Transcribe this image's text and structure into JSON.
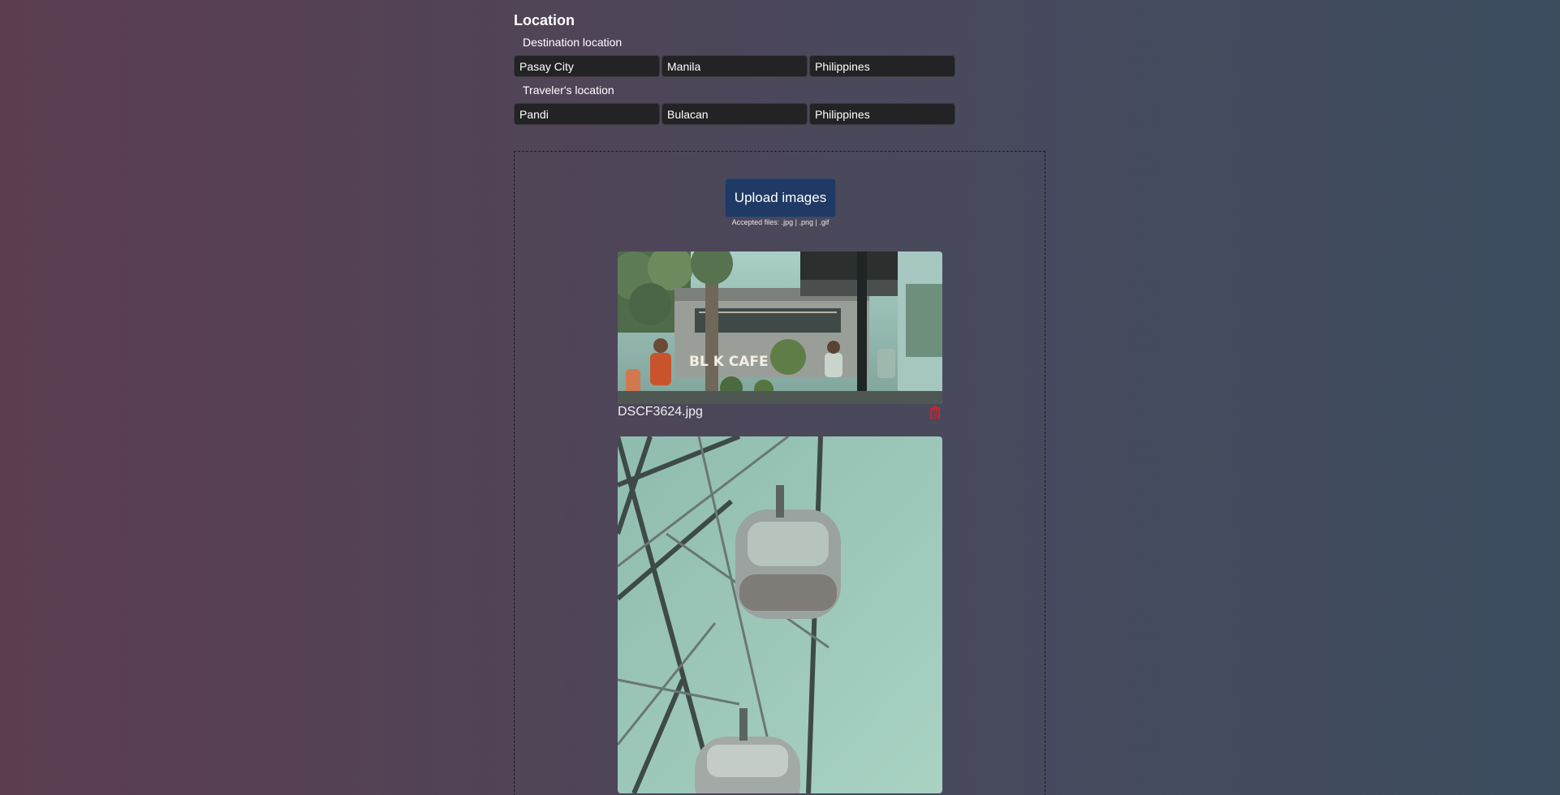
{
  "location": {
    "title": "Location",
    "destination": {
      "label": "Destination location",
      "city": "Pasay City",
      "province": "Manila",
      "country": "Philippines"
    },
    "traveler": {
      "label": "Traveler's location",
      "city": "Pandi",
      "province": "Bulacan",
      "country": "Philippines"
    }
  },
  "upload": {
    "button_label": "Upload images",
    "accepted_text": "Accepted files: .jpg | .png | .gif"
  },
  "images": [
    {
      "file_name": "DSCF3624.jpg",
      "sign_text": "BL  K CAFE"
    },
    {
      "file_name": ""
    }
  ],
  "colors": {
    "upload_button": "#1f3a64",
    "delete_icon": "#c0272d",
    "field_bg": "#232325"
  },
  "icons": {
    "delete": "trash-icon"
  }
}
